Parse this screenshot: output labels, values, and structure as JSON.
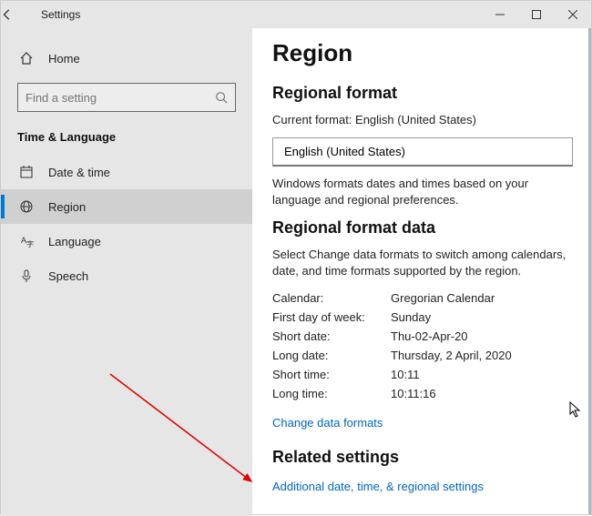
{
  "titlebar": {
    "title": "Settings"
  },
  "sidebar": {
    "home_label": "Home",
    "search_placeholder": "Find a setting",
    "section_title": "Time & Language",
    "items": [
      {
        "label": "Date & time"
      },
      {
        "label": "Region"
      },
      {
        "label": "Language"
      },
      {
        "label": "Speech"
      }
    ]
  },
  "content": {
    "page_title": "Region",
    "regional_format_heading": "Regional format",
    "current_format_label": "Current format: English (United States)",
    "format_dropdown_value": "English (United States)",
    "format_description": "Windows formats dates and times based on your language and regional preferences.",
    "format_data_heading": "Regional format data",
    "format_data_description": "Select Change data formats to switch among calendars, date, and time formats supported by the region.",
    "rows": {
      "calendar_k": "Calendar:",
      "calendar_v": "Gregorian Calendar",
      "fdow_k": "First day of week:",
      "fdow_v": "Sunday",
      "sdate_k": "Short date:",
      "sdate_v": "Thu-02-Apr-20",
      "ldate_k": "Long date:",
      "ldate_v": "Thursday, 2 April, 2020",
      "stime_k": "Short time:",
      "stime_v": "10:11",
      "ltime_k": "Long time:",
      "ltime_v": "10:11:16"
    },
    "change_formats_link": "Change data formats",
    "related_heading": "Related settings",
    "related_link": "Additional date, time, & regional settings"
  }
}
